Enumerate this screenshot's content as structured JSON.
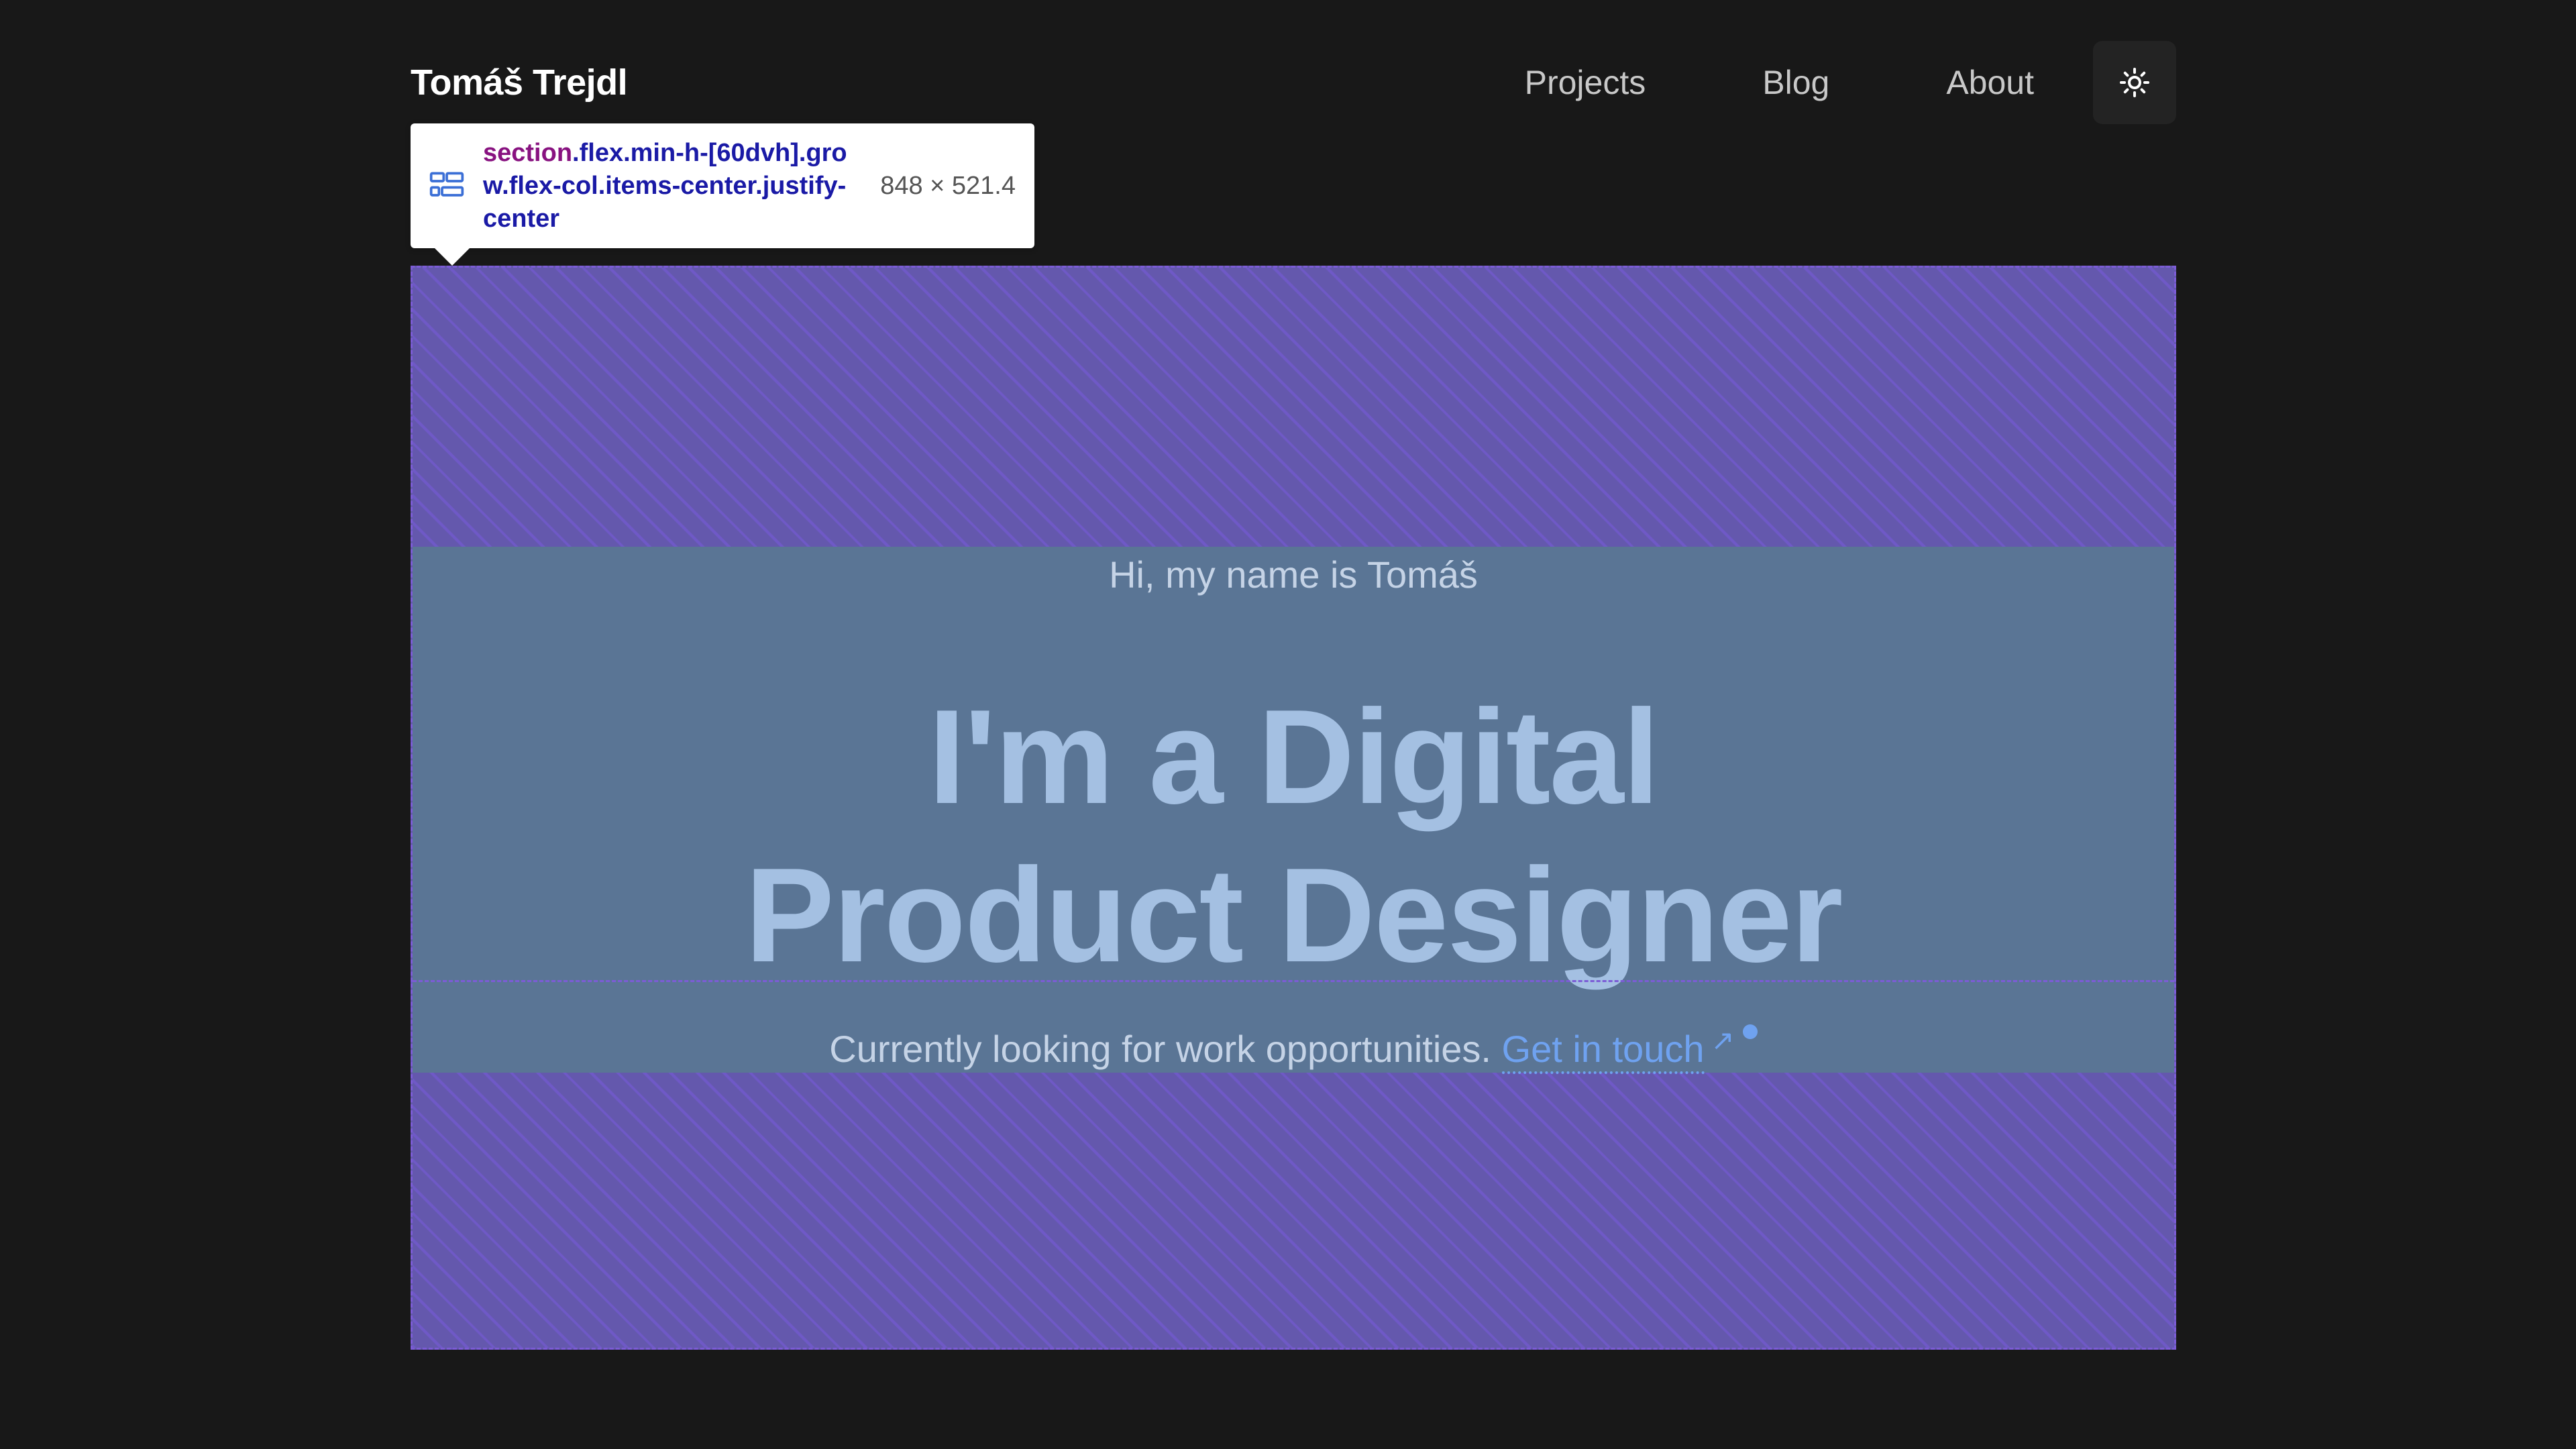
{
  "header": {
    "brand": "Tomáš Trejdl",
    "nav": [
      "Projects",
      "Blog",
      "About"
    ],
    "theme_toggle_icon": "sun-icon"
  },
  "devtools": {
    "selector_tag": "section",
    "selector_classes": ".flex.min-h-[60dvh].grow.flex-col.items-center.justify-center",
    "size": "848 × 521.4",
    "icon": "flex-layout-icon"
  },
  "hero": {
    "intro": "Hi, my name is Tomáš",
    "headline_line1": "I'm a Digital",
    "headline_line2": "Product Designer",
    "subline": "Currently looking for work opportunities.",
    "cta": "Get in touch",
    "cta_icon": "external-arrow-icon"
  },
  "colors": {
    "background": "#181818",
    "highlight": "#6458ad",
    "content_highlight": "#5a7595",
    "link": "#6fa2f0"
  }
}
